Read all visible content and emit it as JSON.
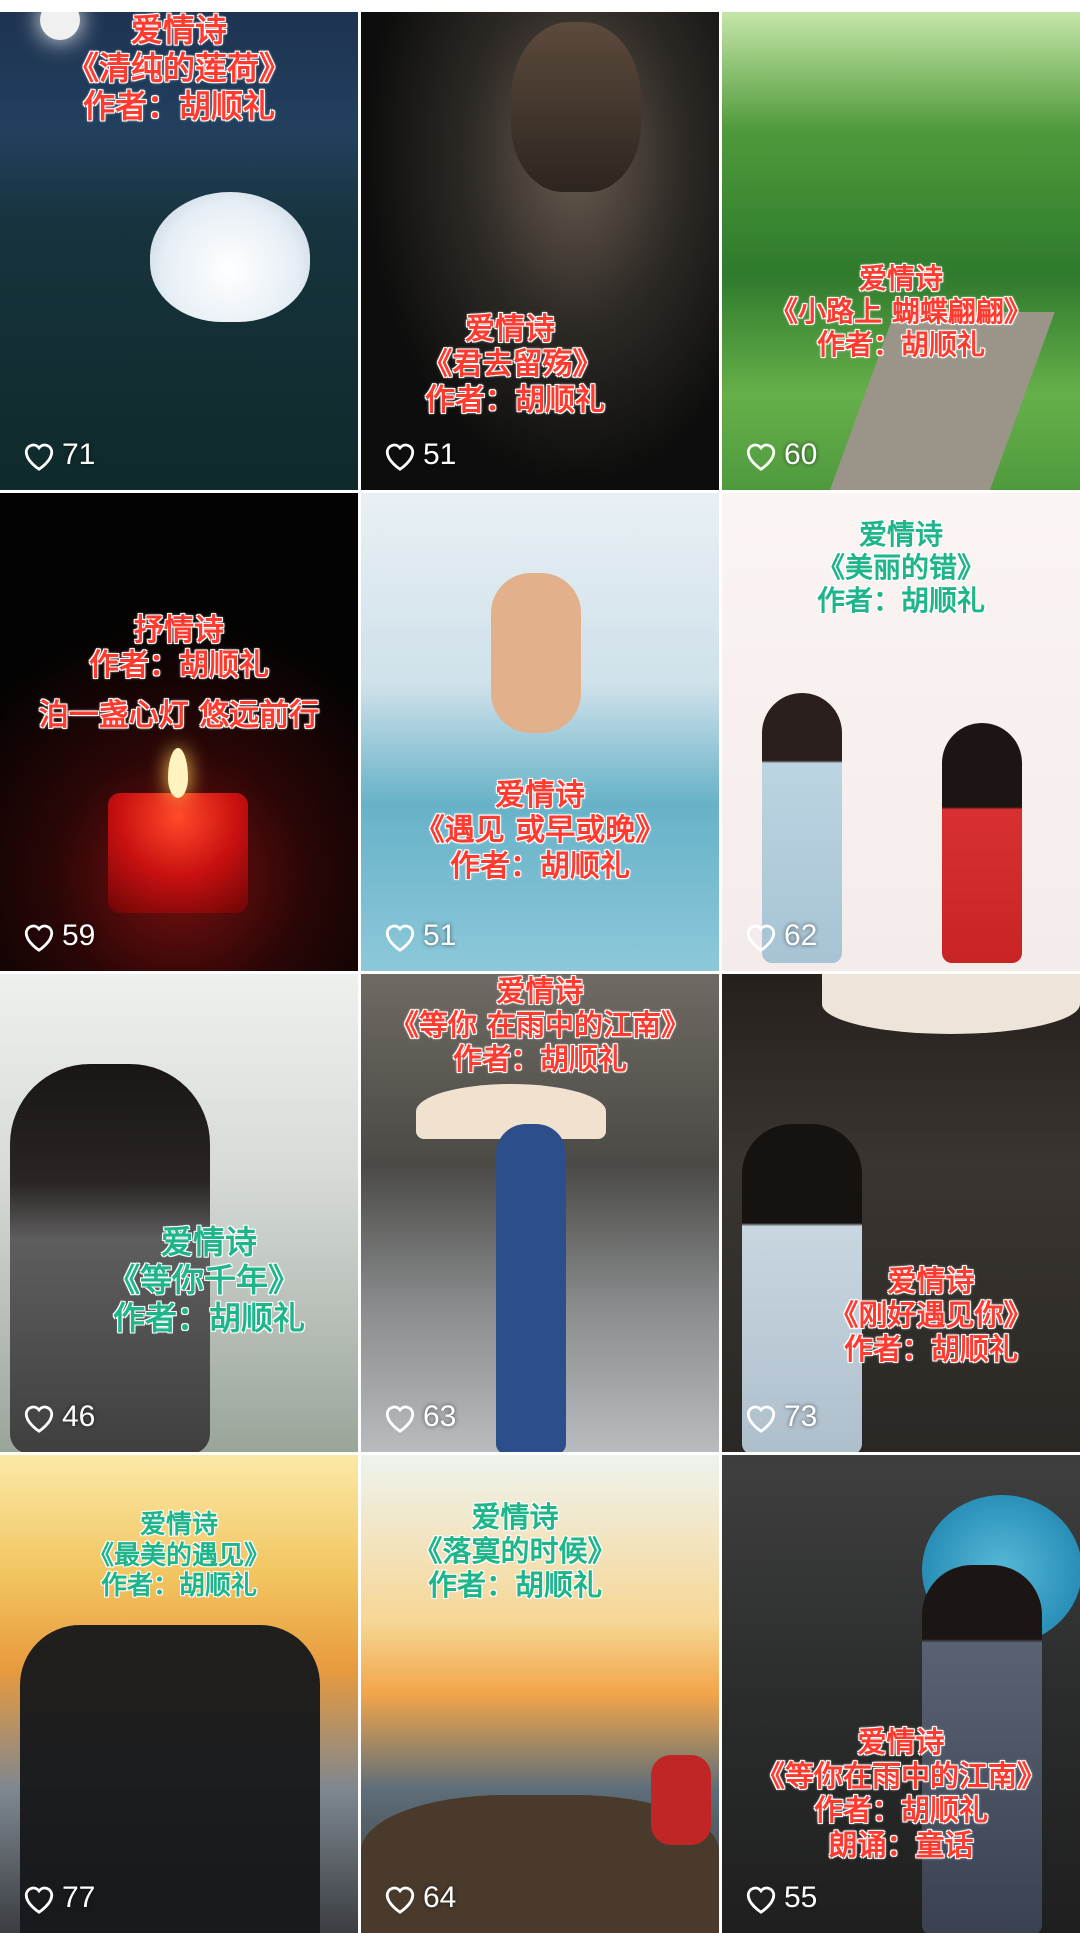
{
  "tiles": [
    {
      "lines": [
        "爱情诗",
        "《清纯的莲荷》",
        "作者：胡顺礼"
      ],
      "likes": "71",
      "scene": "lotus-night"
    },
    {
      "lines": [
        "爱情诗",
        "《君去留殇》",
        "作者：胡顺礼"
      ],
      "likes": "51",
      "scene": "man-dark"
    },
    {
      "lines": [
        "爱情诗",
        "《小路上  蝴蝶翩翩》",
        "作者：胡顺礼"
      ],
      "likes": "60",
      "scene": "forest-path"
    },
    {
      "lines": [
        "抒情诗",
        "作者：胡顺礼",
        "泊一盏心灯 悠远前行"
      ],
      "likes": "59",
      "scene": "candle"
    },
    {
      "lines": [
        "爱情诗",
        "《遇见  或早或晚》",
        "作者：胡顺礼"
      ],
      "likes": "51",
      "scene": "holding-hands"
    },
    {
      "lines": [
        "爱情诗",
        "《美丽的错》",
        "作者：胡顺礼"
      ],
      "likes": "62",
      "scene": "illustrated-couple"
    },
    {
      "lines": [
        "爱情诗",
        "《等你千年》",
        "作者：胡顺礼"
      ],
      "likes": "46",
      "scene": "woman-snow"
    },
    {
      "lines": [
        "爱情诗",
        "《等你  在雨中的江南》",
        "作者：胡顺礼"
      ],
      "likes": "63",
      "scene": "woman-umbrella-street"
    },
    {
      "lines": [
        "爱情诗",
        "《刚好遇见你》",
        "作者：胡顺礼"
      ],
      "likes": "73",
      "scene": "girl-braids"
    },
    {
      "lines": [
        "爱情诗",
        "《最美的遇见》",
        "作者：胡顺礼"
      ],
      "likes": "77",
      "scene": "sunset-couple"
    },
    {
      "lines": [
        "爱情诗",
        "《落寞的时候》",
        "作者：胡顺礼"
      ],
      "likes": "64",
      "scene": "sunset-mountain"
    },
    {
      "lines": [
        "爱情诗",
        "《等你在雨中的江南》",
        "作者：胡顺礼",
        "朗诵：童话"
      ],
      "likes": "55",
      "scene": "qipao-umbrella"
    }
  ],
  "colors": {
    "red_text": "#ff3b30",
    "green_text": "#1fb58a",
    "like_text": "#ffffff"
  },
  "icons": {
    "like": "heart-outline-icon"
  }
}
